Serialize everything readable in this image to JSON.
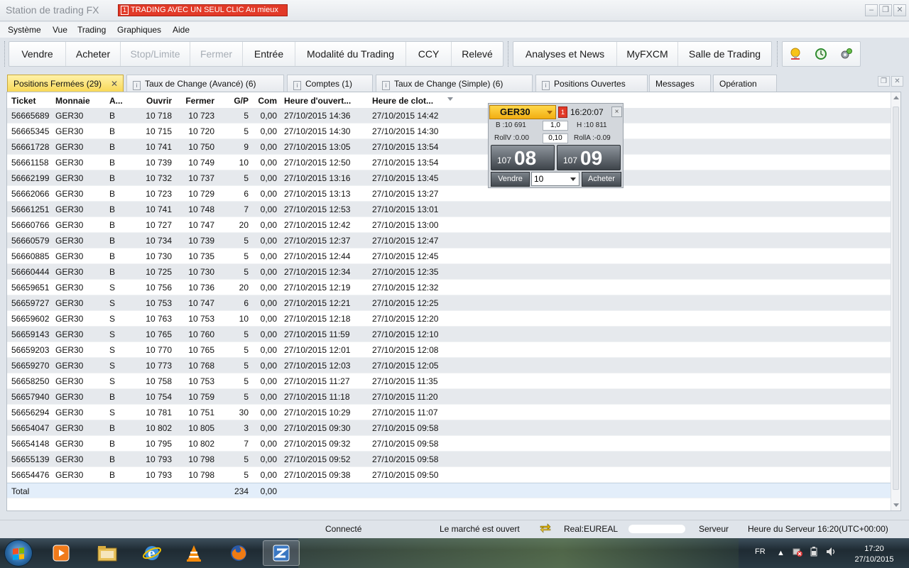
{
  "window": {
    "title": "Station de trading FX",
    "one_click_num": "1",
    "one_click_label": "TRADING AVEC UN SEUL CLIC Au mieux"
  },
  "menu": [
    "Système",
    "Vue",
    "Trading",
    "Graphiques",
    "Aide"
  ],
  "toolbar": {
    "group1": [
      {
        "label": "Vendre",
        "enabled": true
      },
      {
        "label": "Acheter",
        "enabled": true
      },
      {
        "label": "Stop/Limite",
        "enabled": false
      },
      {
        "label": "Fermer",
        "enabled": false
      },
      {
        "label": "Entrée",
        "enabled": true
      },
      {
        "label": "Modalité du Trading",
        "enabled": true
      },
      {
        "label": "CCY",
        "enabled": true
      },
      {
        "label": "Relevé",
        "enabled": true
      }
    ],
    "group2": [
      "Analyses et News",
      "MyFXCM",
      "Salle de Trading"
    ],
    "icons": [
      "lightbulb-pin-icon",
      "clock-arrow-icon",
      "gears-icon"
    ]
  },
  "tabs": [
    {
      "label": "Positions Fermées (29)",
      "active": true,
      "closable": true,
      "icon": false
    },
    {
      "label": "Taux de Change (Avancé) (6)",
      "active": false,
      "icon": true
    },
    {
      "label": "Comptes (1)",
      "active": false,
      "icon": true
    },
    {
      "label": "Taux de Change (Simple) (6)",
      "active": false,
      "icon": true
    },
    {
      "label": "Positions Ouvertes",
      "active": false,
      "icon": true
    },
    {
      "label": "Messages",
      "active": false,
      "icon": false
    },
    {
      "label": "Opération",
      "active": false,
      "icon": false
    }
  ],
  "table": {
    "columns": [
      "Ticket",
      "Monnaie",
      "A...",
      "Ouvrir",
      "Fermer",
      "G/P",
      "Com",
      "Heure d'ouvert...",
      "Heure de clot..."
    ],
    "rows": [
      [
        "56665689",
        "GER30",
        "B",
        "10 718",
        "10 723",
        "5",
        "0,00",
        "27/10/2015 14:36",
        "27/10/2015 14:42"
      ],
      [
        "56665345",
        "GER30",
        "B",
        "10 715",
        "10 720",
        "5",
        "0,00",
        "27/10/2015 14:30",
        "27/10/2015 14:30"
      ],
      [
        "56661728",
        "GER30",
        "B",
        "10 741",
        "10 750",
        "9",
        "0,00",
        "27/10/2015 13:05",
        "27/10/2015 13:54"
      ],
      [
        "56661158",
        "GER30",
        "B",
        "10 739",
        "10 749",
        "10",
        "0,00",
        "27/10/2015 12:50",
        "27/10/2015 13:54"
      ],
      [
        "56662199",
        "GER30",
        "B",
        "10 732",
        "10 737",
        "5",
        "0,00",
        "27/10/2015 13:16",
        "27/10/2015 13:45"
      ],
      [
        "56662066",
        "GER30",
        "B",
        "10 723",
        "10 729",
        "6",
        "0,00",
        "27/10/2015 13:13",
        "27/10/2015 13:27"
      ],
      [
        "56661251",
        "GER30",
        "B",
        "10 741",
        "10 748",
        "7",
        "0,00",
        "27/10/2015 12:53",
        "27/10/2015 13:01"
      ],
      [
        "56660766",
        "GER30",
        "B",
        "10 727",
        "10 747",
        "20",
        "0,00",
        "27/10/2015 12:42",
        "27/10/2015 13:00"
      ],
      [
        "56660579",
        "GER30",
        "B",
        "10 734",
        "10 739",
        "5",
        "0,00",
        "27/10/2015 12:37",
        "27/10/2015 12:47"
      ],
      [
        "56660885",
        "GER30",
        "B",
        "10 730",
        "10 735",
        "5",
        "0,00",
        "27/10/2015 12:44",
        "27/10/2015 12:45"
      ],
      [
        "56660444",
        "GER30",
        "B",
        "10 725",
        "10 730",
        "5",
        "0,00",
        "27/10/2015 12:34",
        "27/10/2015 12:35"
      ],
      [
        "56659651",
        "GER30",
        "S",
        "10 756",
        "10 736",
        "20",
        "0,00",
        "27/10/2015 12:19",
        "27/10/2015 12:32"
      ],
      [
        "56659727",
        "GER30",
        "S",
        "10 753",
        "10 747",
        "6",
        "0,00",
        "27/10/2015 12:21",
        "27/10/2015 12:25"
      ],
      [
        "56659602",
        "GER30",
        "S",
        "10 763",
        "10 753",
        "10",
        "0,00",
        "27/10/2015 12:18",
        "27/10/2015 12:20"
      ],
      [
        "56659143",
        "GER30",
        "S",
        "10 765",
        "10 760",
        "5",
        "0,00",
        "27/10/2015 11:59",
        "27/10/2015 12:10"
      ],
      [
        "56659203",
        "GER30",
        "S",
        "10 770",
        "10 765",
        "5",
        "0,00",
        "27/10/2015 12:01",
        "27/10/2015 12:08"
      ],
      [
        "56659270",
        "GER30",
        "S",
        "10 773",
        "10 768",
        "5",
        "0,00",
        "27/10/2015 12:03",
        "27/10/2015 12:05"
      ],
      [
        "56658250",
        "GER30",
        "S",
        "10 758",
        "10 753",
        "5",
        "0,00",
        "27/10/2015 11:27",
        "27/10/2015 11:35"
      ],
      [
        "56657940",
        "GER30",
        "B",
        "10 754",
        "10 759",
        "5",
        "0,00",
        "27/10/2015 11:18",
        "27/10/2015 11:20"
      ],
      [
        "56656294",
        "GER30",
        "S",
        "10 781",
        "10 751",
        "30",
        "0,00",
        "27/10/2015 10:29",
        "27/10/2015 11:07"
      ],
      [
        "56654047",
        "GER30",
        "B",
        "10 802",
        "10 805",
        "3",
        "0,00",
        "27/10/2015 09:30",
        "27/10/2015 09:58"
      ],
      [
        "56654148",
        "GER30",
        "B",
        "10 795",
        "10 802",
        "7",
        "0,00",
        "27/10/2015 09:32",
        "27/10/2015 09:58"
      ],
      [
        "56655139",
        "GER30",
        "B",
        "10 793",
        "10 798",
        "5",
        "0,00",
        "27/10/2015 09:52",
        "27/10/2015 09:58"
      ],
      [
        "56654476",
        "GER30",
        "B",
        "10 793",
        "10 798",
        "5",
        "0,00",
        "27/10/2015 09:38",
        "27/10/2015 09:50"
      ]
    ],
    "total": {
      "label": "Total",
      "gp": "234",
      "com": "0,00"
    }
  },
  "ticket": {
    "symbol": "GER30",
    "warn": "1",
    "time": "16:20:07",
    "close": "×",
    "low": "B :10 691",
    "amount": "1,0",
    "high": "H :10 811",
    "rollv": "RollV :0.00",
    "roll_step": "0,10",
    "rolla": "RollA :-0.09",
    "sell_prefix": "107",
    "sell_big": "08",
    "buy_prefix": "107",
    "buy_big": "09",
    "sell_label": "Vendre",
    "qty": "10",
    "buy_label": "Acheter"
  },
  "status": {
    "connected": "Connecté",
    "market": "Le marché est ouvert",
    "account": "Real:EUREAL",
    "server": "Serveur",
    "server_time": "Heure du Serveur 16:20(UTC+00:00)"
  },
  "taskbar": {
    "apps": [
      "media-player-icon",
      "file-explorer-icon",
      "internet-explorer-icon",
      "vlc-icon",
      "firefox-icon",
      "trading-station-icon"
    ],
    "lang": "FR",
    "time": "17:20",
    "date": "27/10/2015"
  },
  "colors": {
    "accent_tab": "#f8d858",
    "alert_red": "#e23a28",
    "grid_alt_row": "#e6e9ed"
  }
}
